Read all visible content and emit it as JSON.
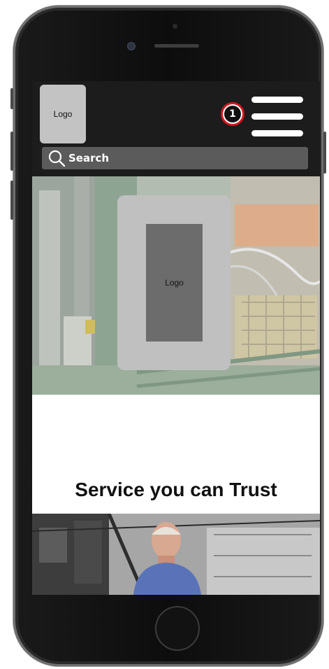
{
  "header": {
    "logo_label": "Logo",
    "notification_count": "1",
    "menu_icon": "hamburger-menu-icon"
  },
  "search": {
    "label": "Search",
    "icon": "search-icon"
  },
  "hero": {
    "logo_label": "Logo"
  },
  "tagline": "Service you can Trust",
  "colors": {
    "header_bg": "#1c1c1c",
    "search_bg": "#5b5b5b",
    "badge_ring": "#d6161f",
    "logo_placeholder": "#c3c3c3",
    "logo_inner": "#6c6c6c"
  }
}
